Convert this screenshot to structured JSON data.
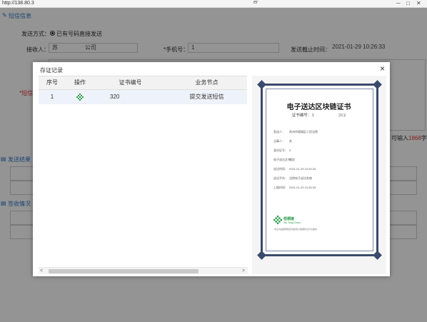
{
  "browser": {
    "url": "http://138.80.3",
    "title_fragment": "er",
    "controls": [
      "─",
      "□",
      "✕"
    ]
  },
  "sms_info": {
    "heading": "短信信息",
    "send_method_label": "发送方式：",
    "send_method_value": "已有号码直接发送",
    "receiver_label": "接收人：",
    "receiver_value": "苏",
    "receiver_suffix": "公司",
    "phone_label": "*手机号：",
    "phone_value": "1",
    "deadline_label": "发送截止时间：",
    "deadline_value": "2021-01-29 10:26:33",
    "content_label": "*短信内",
    "remaining_prefix": "可输入",
    "remaining_count": "1868",
    "remaining_suffix": "字"
  },
  "send_result": {
    "heading": "发送结果"
  },
  "sign_status": {
    "heading": "签收情况"
  },
  "modal": {
    "title": "存证记录",
    "close": "×",
    "table": {
      "columns": [
        "序号",
        "操作",
        "证书编号",
        "业务节点"
      ],
      "rows": [
        {
          "index": "1",
          "cert_no": "320",
          "node": "提交发送短信"
        }
      ]
    },
    "scroll_left": "<",
    "scroll_right": ">"
  },
  "certificate": {
    "title": "电子送达区块链证书",
    "number_label": "证书编号：",
    "number_start": "3",
    "number_end": "312",
    "rows": [
      {
        "label": "发送人：",
        "value": "苏州市相城区人民法院"
      },
      {
        "label": "当事人：",
        "value": "苏"
      },
      {
        "label": "身份证号：",
        "value": "3"
      },
      {
        "label": "电子送达文书：",
        "value": "短信"
      },
      {
        "label": "送达时间：",
        "value": "2021-01-29 10:26:33"
      },
      {
        "label": "送达平台：",
        "value": "法院电子送达系统"
      },
      {
        "label": "上链时间：",
        "value": "2021-01-29 10:26:33"
      }
    ],
    "logo_name": "梧桐链",
    "logo_en": "Wu Tong Chain",
    "footer": "本证书由梧桐链区块链电子数据存证平台提供"
  },
  "colors": {
    "accent": "#2e75c4",
    "remaining": "#d33333",
    "cert_frame": "#3a4a6a",
    "logo_green": "#2a9d4a",
    "row_highlight": "#eef2f9"
  }
}
